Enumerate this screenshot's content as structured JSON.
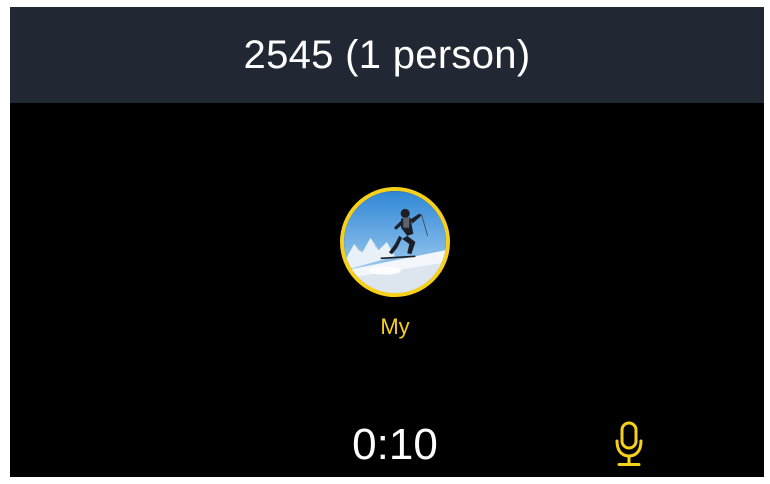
{
  "header": {
    "title": "2545 (1 person)"
  },
  "participant": {
    "name": "My",
    "avatar": "skier-photo"
  },
  "call": {
    "timer": "0:10",
    "mic_icon": "microphone-icon"
  },
  "colors": {
    "header_bg": "#222734",
    "screen_bg": "#000000",
    "accent": "#f7d01c",
    "text": "#ffffff"
  }
}
